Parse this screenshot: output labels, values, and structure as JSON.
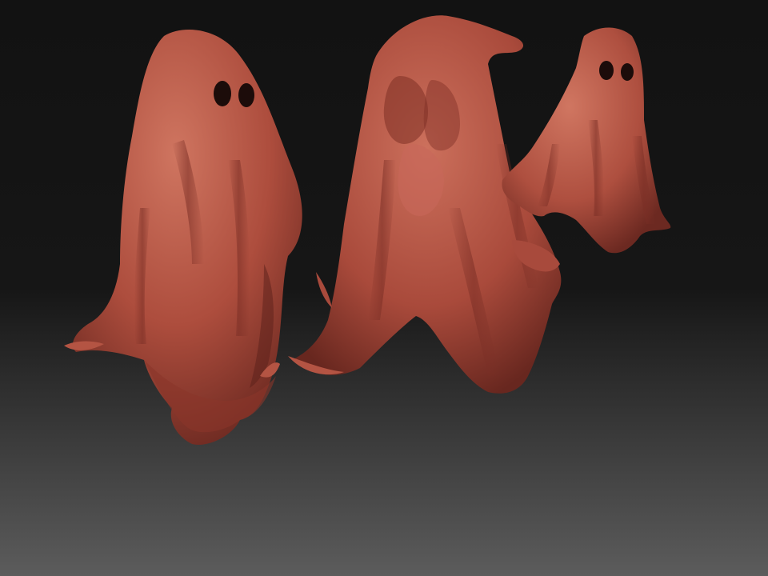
{
  "scene": {
    "background_top": "#121212",
    "background_bottom": "#5a5a5a",
    "clay_light": "#c86a56",
    "clay_base": "#a84a3c",
    "clay_dark": "#6e2a22",
    "clay_shadow": "#4a1a16",
    "eye_color": "#1c0c0a",
    "objects": [
      {
        "name": "ghost-left",
        "description_visible": ""
      },
      {
        "name": "ghost-middle",
        "description_visible": ""
      },
      {
        "name": "ghost-right",
        "description_visible": ""
      }
    ]
  }
}
